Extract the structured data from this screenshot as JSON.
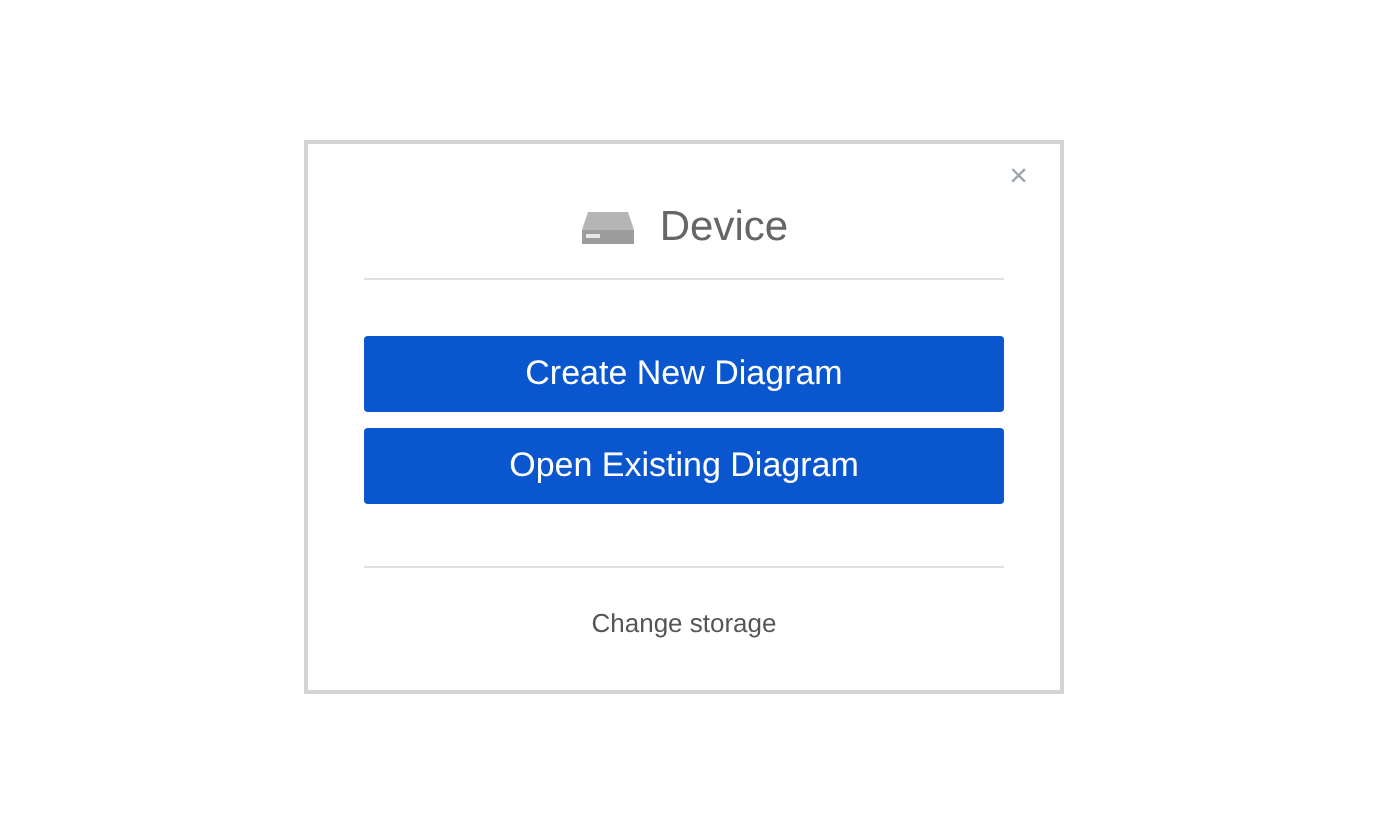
{
  "dialog": {
    "close": "×",
    "title": "Device",
    "buttons": [
      "Create New Diagram",
      "Open Existing Diagram"
    ],
    "footer_link": "Change storage"
  }
}
